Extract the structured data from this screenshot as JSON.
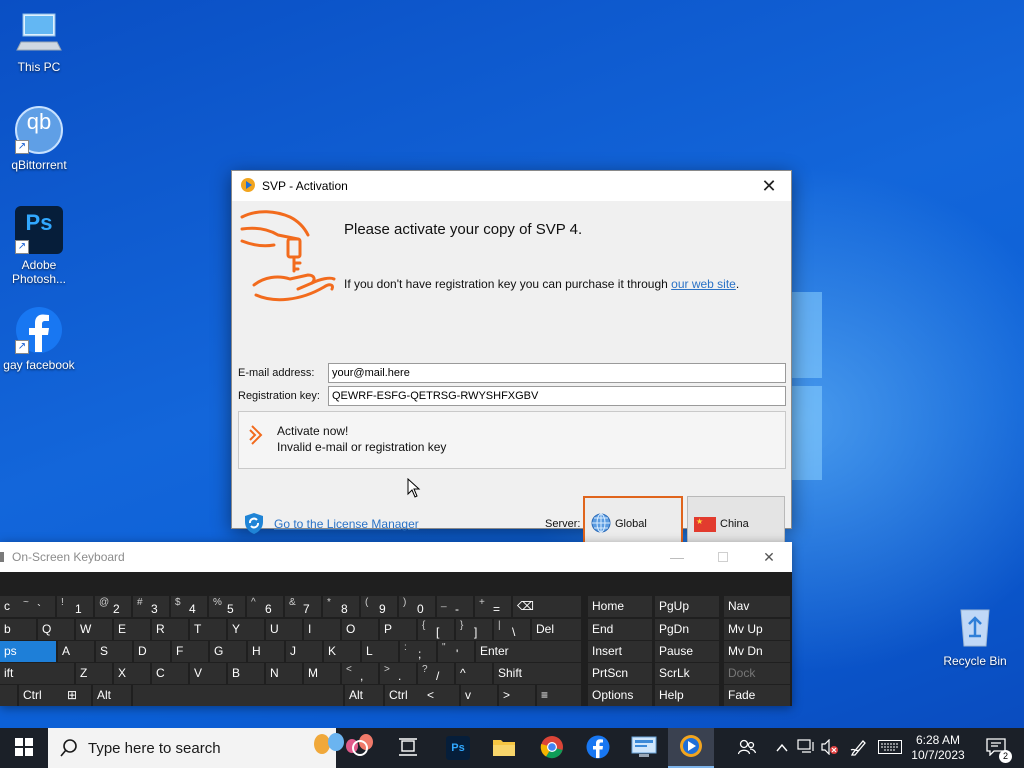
{
  "desktop": {
    "icons": [
      {
        "label": "This PC"
      },
      {
        "label": "qBittorrent"
      },
      {
        "label": "Adobe Photosh..."
      },
      {
        "label": "gay facebook"
      },
      {
        "label": "Recycle Bin"
      }
    ],
    "photoshop_glyph": "Ps",
    "qbittorrent_glyph": "qb"
  },
  "svp": {
    "title": "SVP - Activation",
    "heading": "Please activate your copy of SVP 4.",
    "purchase_text": "If you don't have registration key you can purchase it through ",
    "purchase_link": "our web site",
    "purchase_end": ".",
    "email_label": "E-mail address:",
    "email_value": "your@mail.here",
    "key_label": "Registration key:",
    "key_value": "QEWRF-ESFG-QETRSG-RWYSHFXGBV",
    "activate_title": "Activate now!",
    "activate_status": "Invalid e-mail or registration key",
    "license_link": "Go to the License Manager",
    "server_label": "Server:",
    "server_global": "Global",
    "server_china": "China",
    "selected_server": "Global",
    "accent_color": "#e0651d"
  },
  "osk": {
    "title": "On-Screen Keyboard",
    "rows": [
      [
        [
          "",
          "c"
        ],
        [
          "~",
          "`"
        ],
        [
          "!",
          "1"
        ],
        [
          "@",
          "2"
        ],
        [
          "#",
          "3"
        ],
        [
          "$",
          "4"
        ],
        [
          "%",
          "5"
        ],
        [
          "^",
          "6"
        ],
        [
          "&",
          "7"
        ],
        [
          "*",
          "8"
        ],
        [
          "(",
          "9"
        ],
        [
          ")",
          "0"
        ],
        [
          "_",
          "-"
        ],
        [
          "+",
          "="
        ],
        [
          "",
          "⌫"
        ]
      ],
      [
        [
          "",
          "b"
        ],
        [
          "",
          "Q"
        ],
        [
          "",
          "W"
        ],
        [
          "",
          "E"
        ],
        [
          "",
          "R"
        ],
        [
          "",
          "T"
        ],
        [
          "",
          "Y"
        ],
        [
          "",
          "U"
        ],
        [
          "",
          "I"
        ],
        [
          "",
          "O"
        ],
        [
          "",
          "P"
        ],
        [
          "{",
          "["
        ],
        [
          "}",
          "]"
        ],
        [
          "|",
          "\\"
        ],
        [
          "",
          "Del"
        ]
      ],
      [
        [
          "",
          "ps"
        ],
        [
          "",
          "A"
        ],
        [
          "",
          "S"
        ],
        [
          "",
          "D"
        ],
        [
          "",
          "F"
        ],
        [
          "",
          "G"
        ],
        [
          "",
          "H"
        ],
        [
          "",
          "J"
        ],
        [
          "",
          "K"
        ],
        [
          "",
          "L"
        ],
        [
          ":",
          ";"
        ],
        [
          "\"",
          "'"
        ],
        [
          "",
          "Enter"
        ]
      ],
      [
        [
          "",
          "ift"
        ],
        [
          "",
          "Z"
        ],
        [
          "",
          "X"
        ],
        [
          "",
          "C"
        ],
        [
          "",
          "V"
        ],
        [
          "",
          "B"
        ],
        [
          "",
          "N"
        ],
        [
          "",
          "M"
        ],
        [
          "<",
          ","
        ],
        [
          ">",
          "."
        ],
        [
          "?",
          "/"
        ],
        [
          "",
          "^"
        ],
        [
          "",
          "Shift"
        ]
      ],
      [
        [
          "",
          ""
        ],
        [
          "",
          "Ctrl"
        ],
        [
          "",
          "⊞"
        ],
        [
          "",
          "Alt"
        ],
        [
          "",
          ""
        ],
        [
          "",
          "Alt"
        ],
        [
          "",
          "Ctrl"
        ],
        [
          "",
          "<"
        ],
        [
          "",
          "v"
        ],
        [
          "",
          ">"
        ],
        [
          "",
          "≡"
        ]
      ]
    ],
    "nav": [
      [
        "Home",
        "PgUp",
        "Nav"
      ],
      [
        "End",
        "PgDn",
        "Mv Up"
      ],
      [
        "Insert",
        "Pause",
        "Mv Dn"
      ],
      [
        "PrtScn",
        "ScrLk",
        "Dock"
      ],
      [
        "Options",
        "Help",
        "Fade"
      ]
    ]
  },
  "taskbar": {
    "search_placeholder": "Type here to search",
    "apps": [
      "task-view-icon",
      "photoshop-icon",
      "file-explorer-icon",
      "chrome-icon",
      "facebook-icon",
      "control-panel-icon",
      "svp-icon"
    ],
    "ps_glyph": "Ps",
    "clock_time": "6:28 AM",
    "clock_date": "10/7/2023",
    "notification_count": "2"
  }
}
